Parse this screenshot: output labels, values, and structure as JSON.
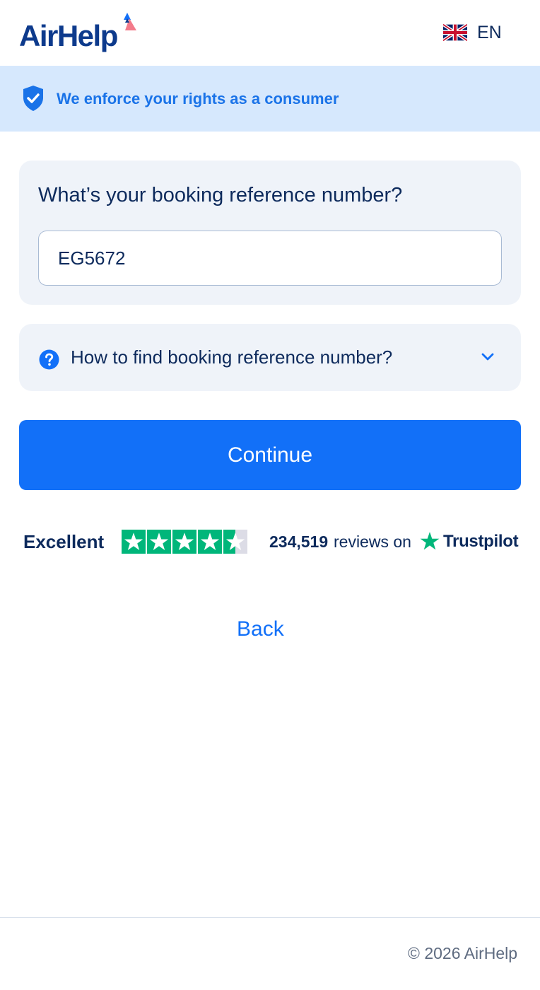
{
  "header": {
    "logo_text": "AirHelp",
    "language_code": "EN",
    "flag": "uk-flag-icon"
  },
  "banner": {
    "icon": "shield-check-icon",
    "text": "We enforce your rights as a consumer"
  },
  "booking": {
    "question": "What’s your booking reference number?",
    "input_value": "EG5672"
  },
  "help": {
    "icon": "question-circle-icon",
    "text": "How to find booking reference number?",
    "chevron": "chevron-down-icon"
  },
  "actions": {
    "continue_label": "Continue",
    "back_label": "Back"
  },
  "trustpilot": {
    "rating_label": "Excellent",
    "stars": 4.5,
    "stars_max": 5,
    "review_count": "234,519",
    "reviews_on": "reviews on",
    "brand": "Trustpilot"
  },
  "footer": {
    "copyright": "© 2026 AirHelp"
  },
  "colors": {
    "brand_navy": "#0d2a5c",
    "primary_blue": "#1270f8",
    "banner_bg": "#d6e8fd",
    "card_bg": "#eff3f9",
    "trustpilot_green": "#00b67a"
  }
}
